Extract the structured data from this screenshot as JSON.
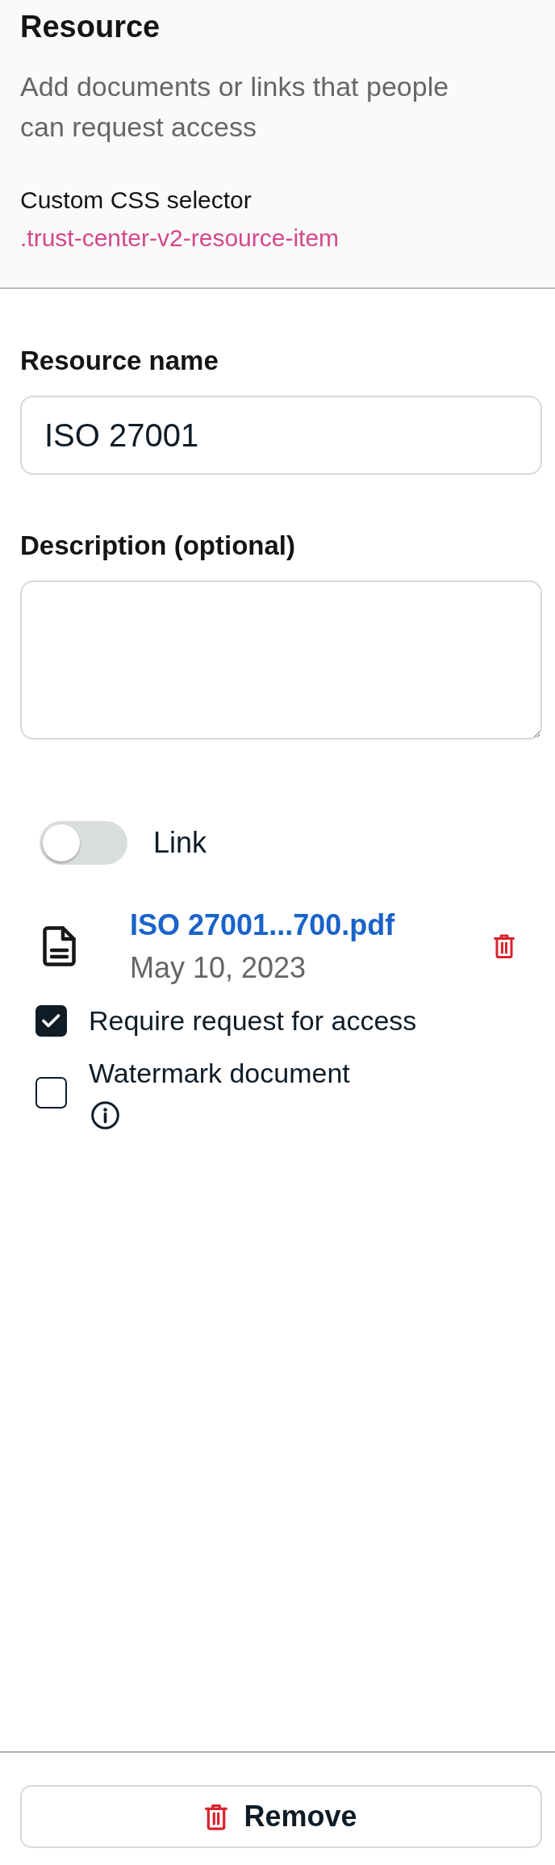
{
  "header": {
    "title": "Resource",
    "description": "Add documents or links that people can request access",
    "selector_label": "Custom CSS selector",
    "selector": ".trust-center-v2-resource-item"
  },
  "fields": [
    {
      "kind": "input",
      "label": "Resource name",
      "value": "ISO 27001"
    },
    {
      "kind": "textarea",
      "label": "Description (optional)"
    }
  ],
  "link_toggle": {
    "label": "Link",
    "on": false
  },
  "file": {
    "name": "ISO 27001...700.pdf",
    "date": "May 10, 2023"
  },
  "options": [
    {
      "label": "Require request for access",
      "checked": true,
      "info": false
    },
    {
      "label": "Watermark document",
      "checked": false,
      "info": true
    }
  ],
  "remove_button": {
    "label": "Remove"
  }
}
